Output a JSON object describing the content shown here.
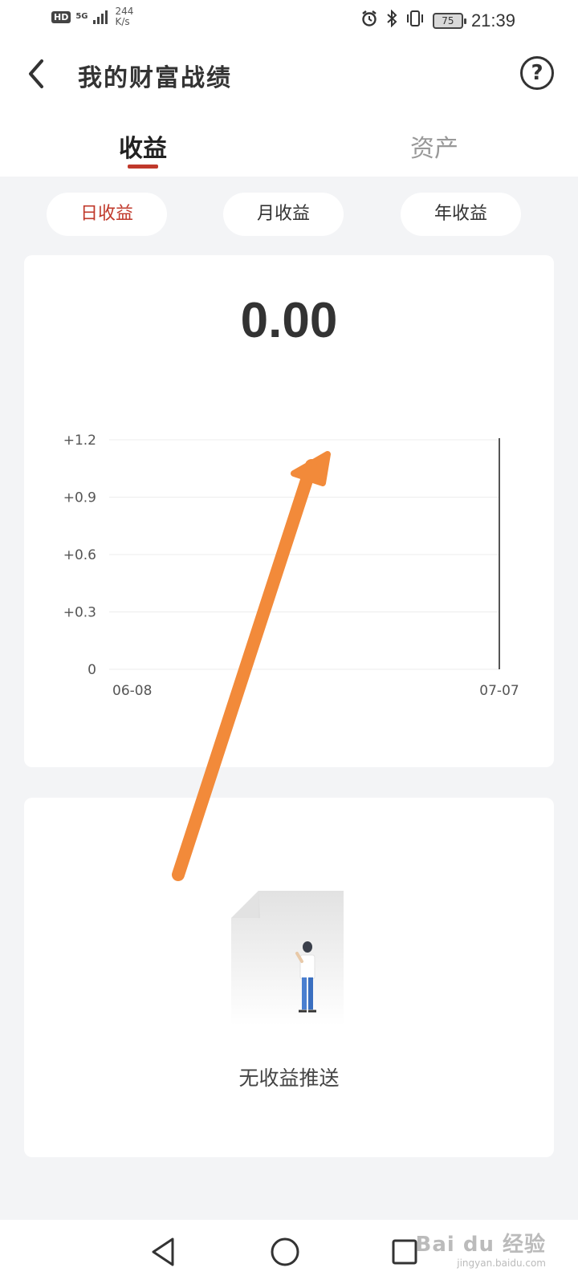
{
  "status_bar": {
    "hd": "HD",
    "network": "5G",
    "speed_value": "244",
    "speed_unit": "K/s",
    "battery": "75",
    "time": "21:39"
  },
  "header": {
    "title": "我的财富战绩",
    "help_icon": "help-circle-icon",
    "back_icon": "chevron-left-icon"
  },
  "tabs": [
    {
      "label": "收益",
      "active": true
    },
    {
      "label": "资产",
      "active": false
    }
  ],
  "periods": [
    {
      "label": "日收益",
      "active": true
    },
    {
      "label": "月收益",
      "active": false
    },
    {
      "label": "年收益",
      "active": false
    }
  ],
  "summary": {
    "value": "0.00"
  },
  "chart_data": {
    "type": "line",
    "x": [
      "06-08",
      "07-07"
    ],
    "y_ticks": [
      "+1.2",
      "+0.9",
      "+0.6",
      "+0.3",
      "0"
    ],
    "ylim": [
      0,
      1.2
    ],
    "series": [],
    "grid": true,
    "cursor_at": "07-07"
  },
  "empty_state": {
    "message": "无收益推送"
  },
  "watermark": {
    "main": "Bai du 经验",
    "sub": "jingyan.baidu.com"
  },
  "colors": {
    "accent": "#c0392b",
    "annotation_arrow": "#f28a3a"
  }
}
